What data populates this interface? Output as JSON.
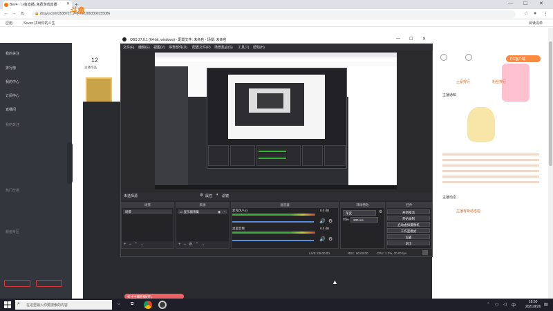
{
  "browser": {
    "tab_title": "Bev4 - 斗鱼直播_免费游戏直播",
    "url": "douyu.com/2538727_r=0.7922893309155086",
    "bookmarks": [
      "应用",
      "Seven 拼出你的人生"
    ],
    "bookmarks_right": "阅读清单"
  },
  "douyu": {
    "room_count": "12",
    "room_count_label": "主播作品",
    "sidebar_items": [
      "我的关注",
      "排行榜",
      "我的中心",
      "订阅中心",
      "直播间"
    ],
    "sidebar_section_labels": [
      "我的关注",
      "热门分类",
      "颜值专区"
    ],
    "pc_button": "PC客户端",
    "right_texts": [
      "土豪排行",
      "粉丝排行",
      "主播通知",
      "主播动态",
      "主播有新动态啦"
    ]
  },
  "obs": {
    "title": "OBS 27.0.1 (64-bit, windows) - 配置文件: 未命名 - 场景: 未命名",
    "menu": [
      "文件(F)",
      "编辑(E)",
      "视图(V)",
      "停靠部件(D)",
      "配置文件(P)",
      "场景集合(S)",
      "工具(T)",
      "帮助(H)"
    ],
    "source_bar": "未选择源",
    "source_bar_props": "属性",
    "source_bar_filters": "滤镜",
    "dock_titles": [
      "场景",
      "来源",
      "混音器",
      "转场特效",
      "控件"
    ],
    "scene_item": "场景",
    "source_item": "显示器采集",
    "mixer_tracks": [
      {
        "name": "桌面音频",
        "level": "0.0 dB"
      },
      {
        "name": "麦克风/Aux",
        "level": "0.0 dB"
      }
    ],
    "transition_type": "渐变",
    "transition_duration_label": "时长",
    "transition_duration_value": "300 ms",
    "controls": [
      "开始推流",
      "开始录制",
      "启动虚拟摄像机",
      "工作室模式",
      "设置",
      "退出"
    ],
    "status": {
      "live": "LIVE: 00:00:00",
      "rec": "REC: 00:00:00",
      "cpu": "CPU: 1.2%, 30.00 fps"
    }
  },
  "taskbar": {
    "search_placeholder": "在这里输入你要搜索的内容",
    "time": "18:50",
    "date": "2021/9/26",
    "toast": "关注主播直播好礼"
  },
  "colors": {
    "douyu_orange": "#ff7700",
    "obs_bg": "#2a2a2d",
    "taskbar": "#1f1f2a"
  }
}
